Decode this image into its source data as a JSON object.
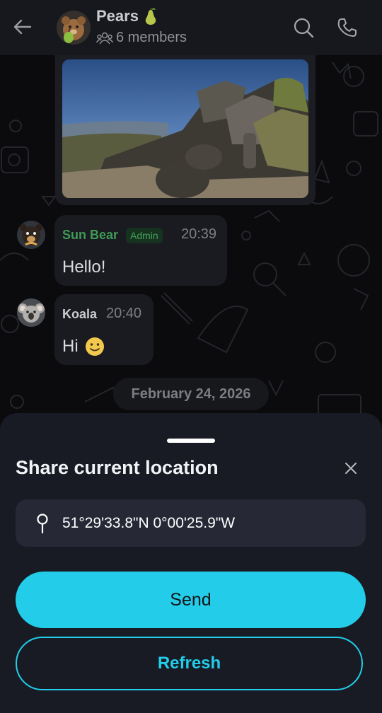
{
  "header": {
    "group_name": "Pears",
    "members": "6 members"
  },
  "messages": [
    {
      "sender": "Sun Bear",
      "badge": "Admin",
      "time": "20:39",
      "text": "Hello!"
    },
    {
      "sender": "Koala",
      "time": "20:40",
      "text": "Hi"
    }
  ],
  "date_separator": "February 24, 2026",
  "sheet": {
    "title": "Share current location",
    "coordinates": "51°29'33.8\"N 0°00'25.9\"W",
    "send_label": "Send",
    "refresh_label": "Refresh"
  },
  "colors": {
    "accent": "#23cde9",
    "sheet_bg": "#181b24",
    "admin_green": "#43a05a"
  }
}
